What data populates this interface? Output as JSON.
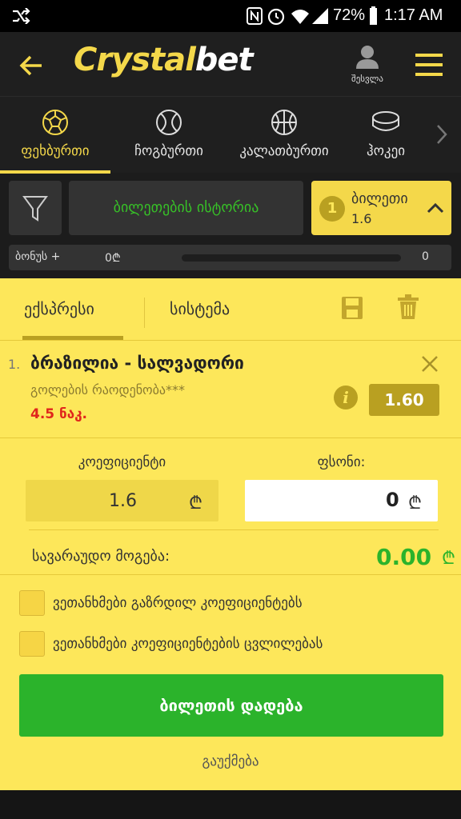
{
  "status_bar": {
    "battery": "72%",
    "time": "1:17 AM"
  },
  "header": {
    "logo_part1": "Crystal",
    "logo_part2": "bet",
    "login_label": "შესვლა"
  },
  "sports": [
    {
      "label": "ფეხბურთი",
      "icon": "soccer-ball-icon",
      "active": true
    },
    {
      "label": "ჩოგბურთი",
      "icon": "tennis-ball-icon",
      "active": false
    },
    {
      "label": "კალათბურთი",
      "icon": "basketball-icon",
      "active": false
    },
    {
      "label": "ჰოკეი",
      "icon": "hockey-puck-icon",
      "active": false
    }
  ],
  "toolbar": {
    "history_label": "ბილეთების ისტორია",
    "ticket_count": "1",
    "ticket_label": "ბილეთი",
    "ticket_odds": "1.6"
  },
  "bonus": {
    "label": "ბონუს +",
    "amount": "0₾",
    "value": "0"
  },
  "bet_tabs": {
    "express": "ექსპრესი",
    "system": "სისტემა"
  },
  "bet_item": {
    "index": "1.",
    "match": "ბრაზილია - სალვადორი",
    "market": "გოლების რაოდენობა***",
    "selection": "4.5 ნაკ.",
    "odds": "1.60"
  },
  "fields": {
    "coefficient_label": "კოეფიციენტი",
    "coefficient_value": "1.6",
    "stake_label": "ფსონი:",
    "stake_value": "0",
    "currency": "₾"
  },
  "win": {
    "label": "სავარაუდო მოგება:",
    "value": "0.00",
    "currency": "₾"
  },
  "checkboxes": [
    "ვეთანხმები გაზრდილ კოეფიციენტებს",
    "ვეთანხმები კოეფიციენტების ცვლილებას"
  ],
  "buttons": {
    "place_bet": "ბილეთის დადება",
    "cancel": "გაუქმება"
  },
  "colors": {
    "accent": "#f4d84a",
    "panel": "#fde75a",
    "green": "#2bb32b",
    "red": "#e0261c"
  }
}
